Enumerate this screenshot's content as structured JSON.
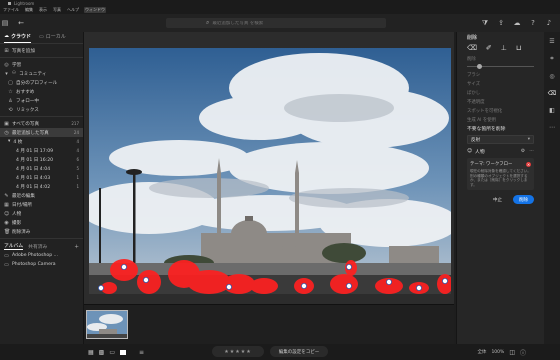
{
  "window": {
    "title": "Lightroom"
  },
  "menu": [
    "ファイル",
    "編集",
    "表示",
    "写真",
    "ヘルプ",
    "ウィンドウ"
  ],
  "toolbar": {
    "search_placeholder": "最近追加した写真 を検索"
  },
  "sidebar": {
    "tabs": {
      "cloud": "クラウド",
      "local": "ローカル"
    },
    "add_photos": "写真を追加",
    "learn": "学習",
    "community": "コミュニティ",
    "community_items": [
      "自分のプロフィール",
      "おすすめ",
      "フォロー中",
      "リミックス"
    ],
    "all_photos": "すべての写真",
    "all_count": "217",
    "recent": "最近追加した写真",
    "recent_count": "24",
    "date_groups": [
      {
        "label": "4 枚",
        "count": "4"
      },
      {
        "label": "4 月 01 日 17:09",
        "count": "4"
      },
      {
        "label": "4 月 01 日 16:20",
        "count": "6"
      },
      {
        "label": "4 月 01 日 4:04",
        "count": "5"
      },
      {
        "label": "4 月 01 日 4:03",
        "count": "1"
      },
      {
        "label": "4 月 01 日 4:02",
        "count": "1"
      }
    ],
    "more_items": [
      {
        "label": "最近の編集",
        "count": ""
      },
      {
        "label": "日付/場所",
        "count": ""
      },
      {
        "label": "人物",
        "count": ""
      },
      {
        "label": "撮影",
        "count": ""
      },
      {
        "label": "削除済み",
        "count": ""
      }
    ],
    "album_tabs": {
      "albums": "アルバム",
      "shared": "共有済み"
    },
    "albums": [
      "Adobe Photoshop ...",
      "Photoshop Camera"
    ]
  },
  "bottombar": {
    "stars": "★★★★★",
    "copy_label": "編集の設定をコピー",
    "zoom_label": "全体",
    "zoom_value": "100%"
  },
  "rpanel": {
    "title": "削除",
    "rows": [
      "削除",
      "ブラシ",
      "サイズ",
      "ぼかし",
      "不透明度",
      "スポットを可視化"
    ],
    "generative": "生成 AI を使用",
    "detect_title": "不要な箇所を削除",
    "select_value": "反射",
    "people_label": "人物",
    "tip_title": "テーマ: ワークフロー",
    "tip_body": "現在の削除対象を確認してください。別の種類のオブジェクトを選択するか、または［削除］をクリックします。",
    "btn_cancel": "中止",
    "btn_apply": "削除"
  },
  "colors": {
    "accent": "#1473e6",
    "highlight": "#ff2020",
    "marker": "#ffffff"
  }
}
